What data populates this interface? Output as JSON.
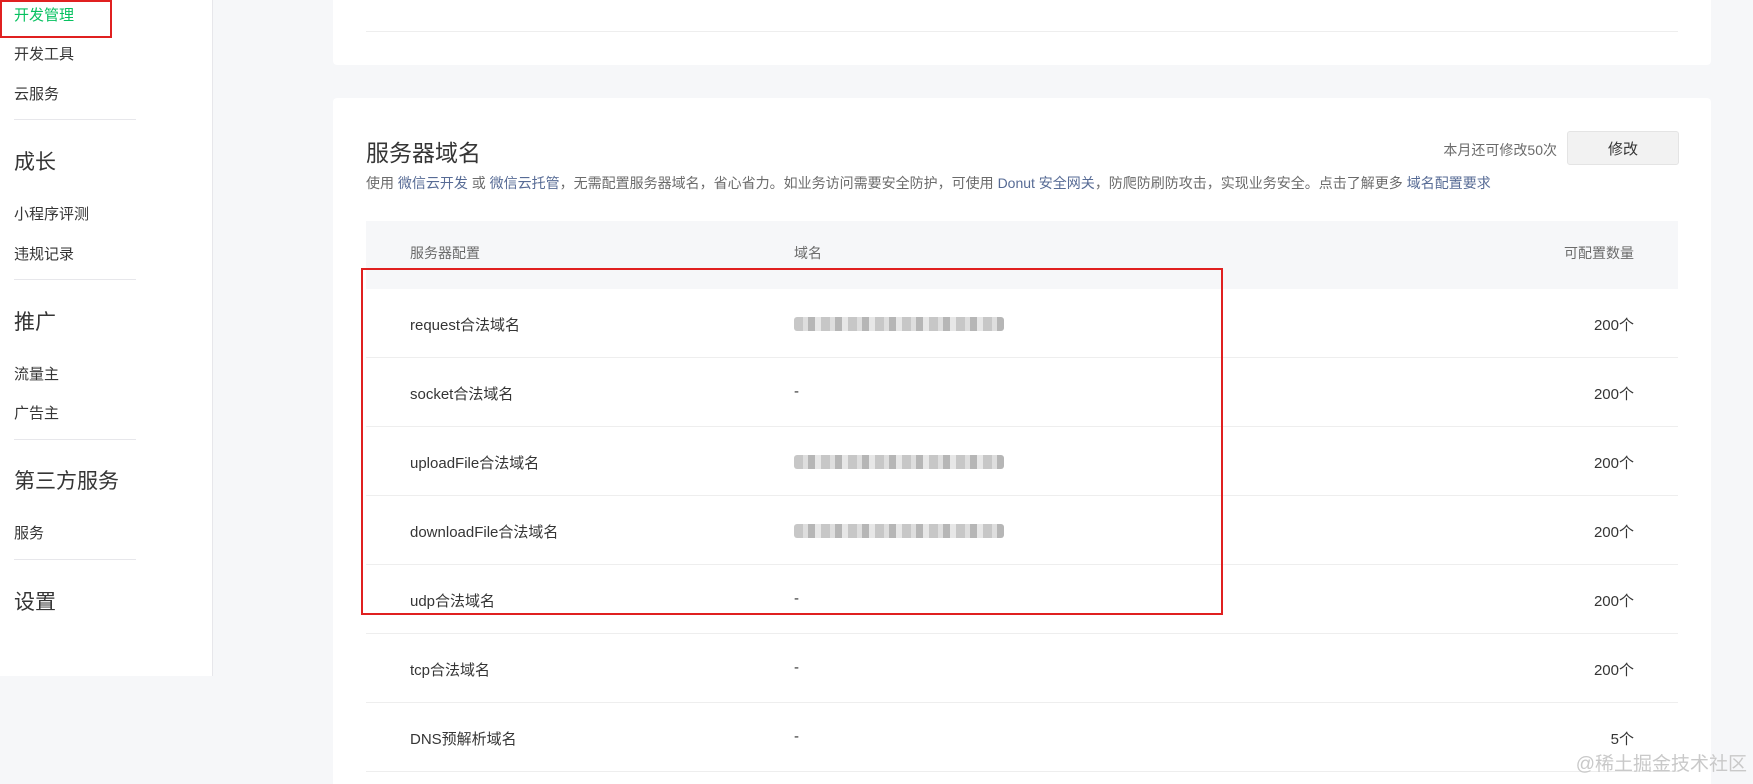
{
  "sidebar": {
    "items": [
      {
        "label": "开发管理",
        "active": true
      },
      {
        "label": "开发工具"
      },
      {
        "label": "云服务"
      }
    ],
    "groups": [
      {
        "title": "成长",
        "items": [
          "小程序评测",
          "违规记录"
        ]
      },
      {
        "title": "推广",
        "items": [
          "流量主",
          "广告主"
        ]
      },
      {
        "title": "第三方服务",
        "items": [
          "服务"
        ]
      },
      {
        "title": "设置",
        "items": []
      }
    ]
  },
  "section": {
    "title": "服务器域名",
    "quota_text": "本月还可修改50次",
    "modify_label": "修改",
    "desc": {
      "p1": "使用 ",
      "link1": "微信云开发",
      "p2": " 或 ",
      "link2": "微信云托管",
      "p3": "，无需配置服务器域名，省心省力。如业务访问需要安全防护，可使用 ",
      "link3": "Donut 安全网关",
      "p4": "，防爬防刷防攻击，实现业务安全。点击了解更多 ",
      "link4": "域名配置要求"
    }
  },
  "table": {
    "headers": [
      "服务器配置",
      "域名",
      "可配置数量"
    ],
    "rows": [
      {
        "name": "request合法域名",
        "domain": "",
        "blurred": true,
        "count": "200个"
      },
      {
        "name": "socket合法域名",
        "domain": "-",
        "blurred": false,
        "count": "200个"
      },
      {
        "name": "uploadFile合法域名",
        "domain": "",
        "blurred": true,
        "count": "200个"
      },
      {
        "name": "downloadFile合法域名",
        "domain": "",
        "blurred": true,
        "count": "200个"
      },
      {
        "name": "udp合法域名",
        "domain": "-",
        "blurred": false,
        "count": "200个"
      },
      {
        "name": "tcp合法域名",
        "domain": "-",
        "blurred": false,
        "count": "200个"
      },
      {
        "name": "DNS预解析域名",
        "domain": "-",
        "blurred": false,
        "count": "5个"
      }
    ]
  },
  "watermark": "@稀土掘金技术社区"
}
